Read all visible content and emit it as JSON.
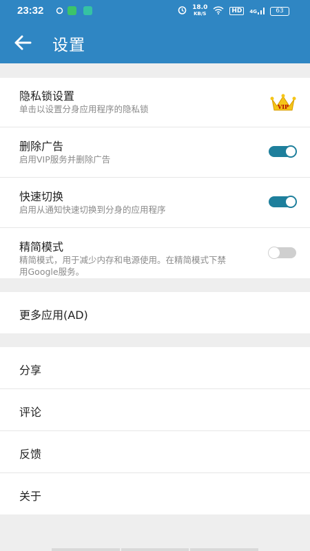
{
  "status_bar": {
    "time": "23:32",
    "net_speed": "18.0",
    "net_unit": "KB/S",
    "hd": "HD",
    "signal": "4G",
    "battery": "63"
  },
  "app_bar": {
    "title": "设置"
  },
  "settings": [
    {
      "label": "隐私锁设置",
      "sub": "单击以设置分身应用程序的隐私锁",
      "badge": "VIP"
    },
    {
      "label": "删除广告",
      "sub": "启用VIP服务并删除广告",
      "toggle": true
    },
    {
      "label": "快速切换",
      "sub": "启用从通知快速切换到分身的应用程序",
      "toggle": true
    },
    {
      "label": "精简模式",
      "sub_line1": "精简模式，用于减少内存和电源使用。在精简模式下禁",
      "sub_line2": "用Google服务。",
      "toggle": false
    }
  ],
  "more_apps": {
    "label": "更多应用(AD)"
  },
  "misc": [
    {
      "label": "分享"
    },
    {
      "label": "评论"
    },
    {
      "label": "反馈"
    },
    {
      "label": "关于"
    }
  ],
  "colors": {
    "primary": "#2f86c3",
    "toggle_on": "#1e7f9c",
    "background": "#eeeeee"
  },
  "icons": [
    "back-arrow-icon",
    "crown-vip-icon",
    "alarm-icon",
    "wifi-icon",
    "battery-icon"
  ]
}
